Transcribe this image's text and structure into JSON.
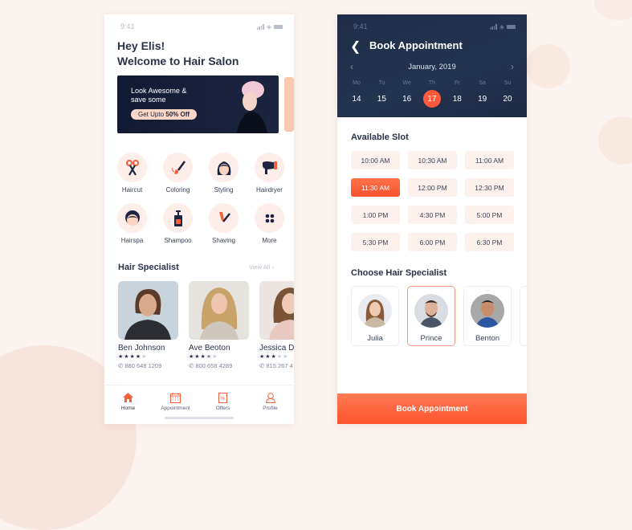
{
  "home": {
    "status_time": "9:41",
    "greeting_line1": "Hey Elis!",
    "greeting_line2": "Welcome to Hair Salon",
    "banner": {
      "line1": "Look Awesome &",
      "line2": "save some",
      "pill_prefix": "Get Upto ",
      "pill_bold": "50% Off"
    },
    "categories": [
      {
        "label": "Haircut",
        "icon": "scissors-icon"
      },
      {
        "label": "Coloring",
        "icon": "brush-icon"
      },
      {
        "label": "Styling",
        "icon": "woman-hair-icon"
      },
      {
        "label": "Hairdryer",
        "icon": "hairdryer-icon"
      },
      {
        "label": "Hairspa",
        "icon": "hairspa-face-icon"
      },
      {
        "label": "Shampoo",
        "icon": "shampoo-bottle-icon"
      },
      {
        "label": "Shaving",
        "icon": "razor-icon"
      },
      {
        "label": "More",
        "icon": "grid-dots-icon"
      }
    ],
    "specialist_title": "Hair Specialist",
    "view_all": "View All",
    "specialists": [
      {
        "name": "Ben Johnson",
        "rating": 4,
        "max_rating": 5,
        "phone": "880 648 1209"
      },
      {
        "name": "Ave Beoton",
        "rating": 3.5,
        "max_rating": 5,
        "phone": "800 658 4289"
      },
      {
        "name": "Jessica D",
        "rating": 3,
        "max_rating": 5,
        "phone": "815 267 4"
      }
    ],
    "tabs": [
      {
        "label": "Home",
        "active": true
      },
      {
        "label": "Appointment",
        "active": false
      },
      {
        "label": "Offers",
        "active": false
      },
      {
        "label": "Profile",
        "active": false
      }
    ]
  },
  "booking": {
    "status_time": "9:41",
    "title": "Book Appointment",
    "month": "January, 2019",
    "days": [
      {
        "name": "Mo",
        "date": "14"
      },
      {
        "name": "Tu",
        "date": "15"
      },
      {
        "name": "We",
        "date": "16"
      },
      {
        "name": "Th",
        "date": "17",
        "selected": true
      },
      {
        "name": "Fr",
        "date": "18"
      },
      {
        "name": "Sa",
        "date": "19"
      },
      {
        "name": "Su",
        "date": "20"
      }
    ],
    "slots_title": "Available Slot",
    "slots": [
      "10:00 AM",
      "10:30 AM",
      "11:00 AM",
      "11:30 AM",
      "12:00 PM",
      "12:30 PM",
      "1:00 PM",
      "4:30 PM",
      "5:00 PM",
      "5:30 PM",
      "6:00 PM",
      "6:30 PM"
    ],
    "selected_slot": "11:30 AM",
    "choose_title": "Choose Hair Specialist",
    "choices": [
      {
        "name": "Julia"
      },
      {
        "name": "Prince",
        "selected": true
      },
      {
        "name": "Benton"
      }
    ],
    "book_button": "Book Appointment"
  },
  "colors": {
    "accent": "#ff5b3a",
    "navy": "#1f2d48",
    "soft_pink": "#fdeeea"
  }
}
